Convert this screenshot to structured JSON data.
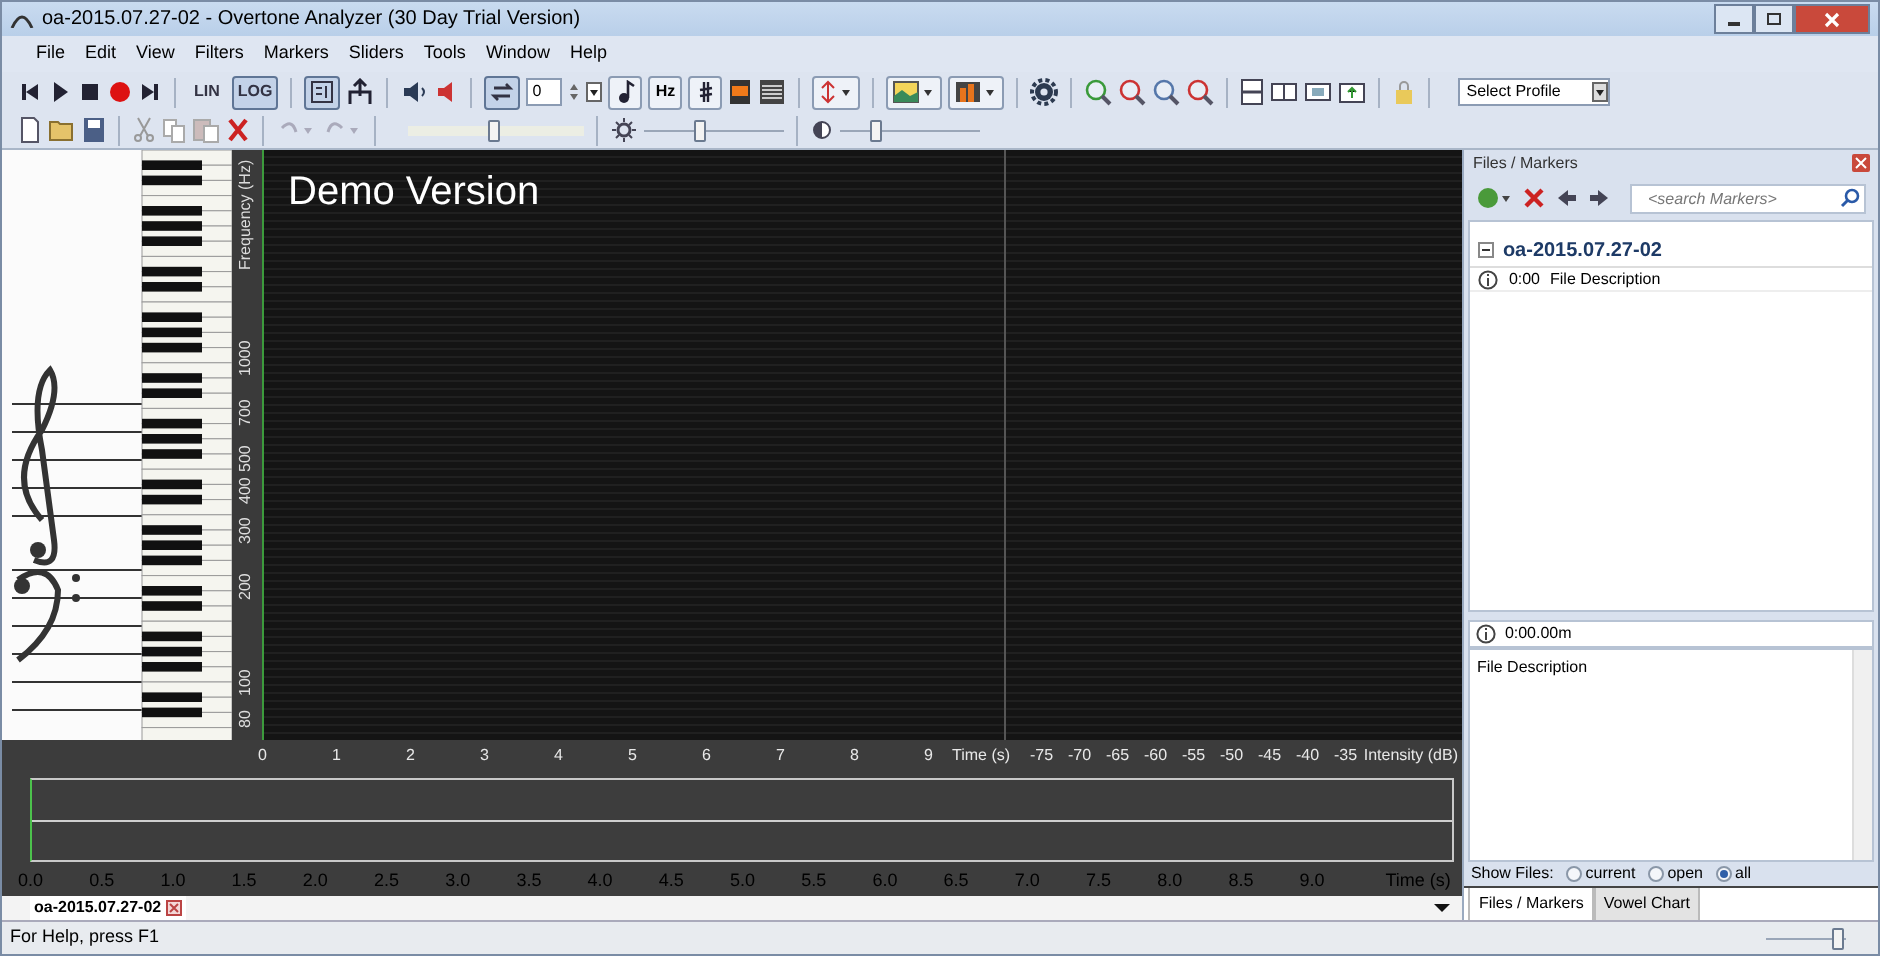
{
  "window": {
    "title": "oa-2015.07.27-02 - Overtone Analyzer (30 Day Trial Version)"
  },
  "menu": [
    "File",
    "Edit",
    "View",
    "Filters",
    "Markers",
    "Sliders",
    "Tools",
    "Window",
    "Help"
  ],
  "toolbar": {
    "scale_buttons": [
      {
        "label": "LIN",
        "selected": false
      },
      {
        "label": "LOG",
        "selected": true
      }
    ],
    "spin_value": "0",
    "hz_button": "Hz",
    "profile_select": "Select Profile",
    "range_slider": {
      "level": 0.49
    },
    "brightness": {
      "level": 0.4
    },
    "contrast": {
      "level": 0.25
    }
  },
  "spectrogram": {
    "overlay": "Demo Version",
    "y_label": "Frequency (Hz)",
    "y_ticks": [
      "1000",
      "700",
      "500",
      "400",
      "300",
      "200",
      "100",
      "80"
    ],
    "x_ticks": [
      "0",
      "1",
      "2",
      "3",
      "4",
      "5",
      "6",
      "7",
      "8",
      "9"
    ],
    "x_label": "Time (s)",
    "intensity_ticks": [
      "-75",
      "-70",
      "-65",
      "-60",
      "-55",
      "-50",
      "-45",
      "-40",
      "-35"
    ],
    "intensity_label": "Intensity (dB)"
  },
  "waveform": {
    "ticks": [
      "0.0",
      "0.5",
      "1.0",
      "1.5",
      "2.0",
      "2.5",
      "3.0",
      "3.5",
      "4.0",
      "4.5",
      "5.0",
      "5.5",
      "6.0",
      "6.5",
      "7.0",
      "7.5",
      "8.0",
      "8.5",
      "9.0"
    ],
    "x_label": "Time (s)"
  },
  "file_tabs": [
    {
      "label": "oa-2015.07.27-02",
      "selected": true
    }
  ],
  "panel": {
    "title": "Files / Markers",
    "search": {
      "placeholder": "<search Markers>"
    },
    "tree": [
      {
        "label": "oa-2015.07.27-02",
        "expanded": true,
        "children": [
          {
            "time": "0:00",
            "label": "File Description"
          }
        ]
      }
    ],
    "position": "0:00.00m",
    "description": "File Description",
    "show_files": {
      "label": "Show Files:",
      "options": [
        {
          "label": "current",
          "selected": false
        },
        {
          "label": "open",
          "selected": false
        },
        {
          "label": "all",
          "selected": true
        }
      ]
    },
    "tabs": [
      {
        "label": "Files / Markers",
        "selected": true
      },
      {
        "label": "Vowel Chart",
        "selected": false
      }
    ]
  },
  "status_bar": {
    "text": "For Help, press F1",
    "zoom": {
      "level": 0.9
    }
  }
}
